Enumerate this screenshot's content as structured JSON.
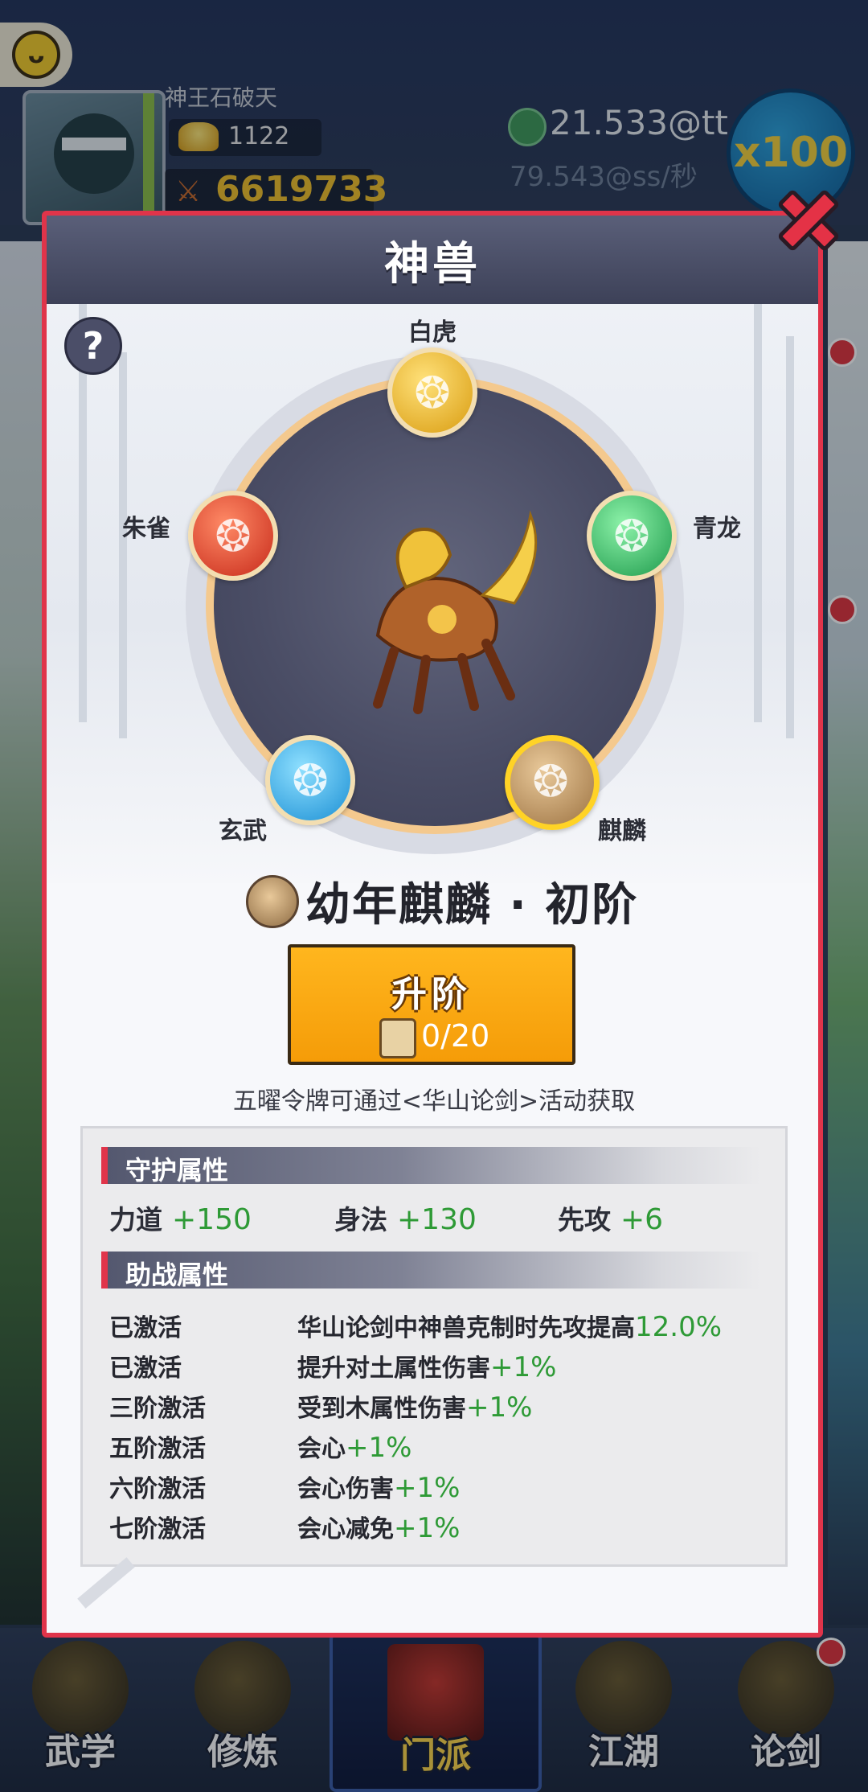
{
  "header": {
    "player_name": "神王石破天",
    "gold": "1122",
    "power": "6619733",
    "rate_main": "21.533@tt",
    "rate_sub": "79.543@ss/秒",
    "multiplier_button": "x100"
  },
  "modal": {
    "title": "神兽",
    "help_label": "?",
    "beasts": [
      {
        "name": "白虎",
        "icon": "tiger-icon"
      },
      {
        "name": "青龙",
        "icon": "dragon-icon"
      },
      {
        "name": "朱雀",
        "icon": "phoenix-icon"
      },
      {
        "name": "玄武",
        "icon": "turtle-icon"
      },
      {
        "name": "麒麟",
        "icon": "qilin-icon",
        "selected": true
      }
    ],
    "current_beast": "幼年麒麟 · 初阶",
    "upgrade": {
      "label": "升阶",
      "token_count": "0/20"
    },
    "hint": "五曜令牌可通过<华山论剑>活动获取",
    "guard_section": {
      "title": "守护属性",
      "stats": [
        {
          "name": "力道",
          "value": "+150"
        },
        {
          "name": "身法",
          "value": "+130"
        },
        {
          "name": "先攻",
          "value": "+6"
        }
      ]
    },
    "support_section": {
      "title": "助战属性",
      "rows": [
        {
          "state": "已激活",
          "desc": "华山论剑中神兽克制时先攻提高",
          "bonus": "12.0%"
        },
        {
          "state": "已激活",
          "desc": "提升对土属性伤害",
          "bonus": "+1%"
        },
        {
          "state": "三阶激活",
          "desc": "受到木属性伤害",
          "bonus": "+1%"
        },
        {
          "state": "五阶激活",
          "desc": "会心",
          "bonus": "+1%"
        },
        {
          "state": "六阶激活",
          "desc": "会心伤害",
          "bonus": "+1%"
        },
        {
          "state": "七阶激活",
          "desc": "会心减免",
          "bonus": "+1%"
        }
      ]
    }
  },
  "bottom_nav": [
    {
      "label": "武学",
      "active": false
    },
    {
      "label": "修炼",
      "active": false
    },
    {
      "label": "门派",
      "active": true
    },
    {
      "label": "江湖",
      "active": false
    },
    {
      "label": "论剑",
      "active": false
    }
  ],
  "colors": {
    "accent_red": "#e0344a",
    "bonus_green": "#2e9a36",
    "button_orange": "#f59c08",
    "selected_ring": "#ffd326"
  }
}
